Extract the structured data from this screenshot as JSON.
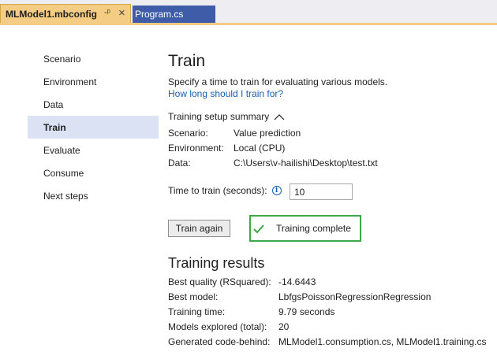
{
  "tabs": {
    "active": {
      "label": "MLModel1.mbconfig",
      "pin": "-क़",
      "close": "×"
    },
    "inactive": {
      "label": "Program.cs"
    }
  },
  "nav": {
    "items": [
      {
        "label": "Scenario"
      },
      {
        "label": "Environment"
      },
      {
        "label": "Data"
      },
      {
        "label": "Train"
      },
      {
        "label": "Evaluate"
      },
      {
        "label": "Consume"
      },
      {
        "label": "Next steps"
      }
    ],
    "selected_index": 3
  },
  "page": {
    "title": "Train",
    "description": "Specify a time to train for evaluating various models.",
    "help_link": "How long should I train for?"
  },
  "summary": {
    "heading": "Training setup summary",
    "rows": [
      {
        "label": "Scenario:",
        "value": "Value prediction"
      },
      {
        "label": "Environment:",
        "value": "Local (CPU)"
      },
      {
        "label": "Data:",
        "value": "C:\\Users\\v-hailishi\\Desktop\\test.txt"
      }
    ]
  },
  "time_to_train": {
    "label": "Time to train (seconds):",
    "info_icon": "i",
    "value": "10"
  },
  "actions": {
    "train_again": "Train again",
    "status": "Training complete"
  },
  "results": {
    "title": "Training results",
    "rows": [
      {
        "label": "Best quality (RSquared):",
        "value": "-14.6443"
      },
      {
        "label": "Best model:",
        "value": "LbfgsPoissonRegressionRegression"
      },
      {
        "label": "Training time:",
        "value": "9.79 seconds"
      },
      {
        "label": "Models explored (total):",
        "value": "20"
      },
      {
        "label": "Generated code-behind:",
        "value": "MLModel1.consumption.cs, MLModel1.training.cs"
      }
    ]
  },
  "colors": {
    "active_tab": "#f5cc84",
    "inactive_tab": "#3f5ca8",
    "nav_selected": "#dbe2f3",
    "link": "#1a5fb4",
    "success": "#3aaa48"
  },
  "icons": {
    "collapse": "chevron-up-icon",
    "status": "checkmark-icon",
    "info": "info-icon",
    "pin": "pin-icon",
    "close": "close-icon"
  }
}
